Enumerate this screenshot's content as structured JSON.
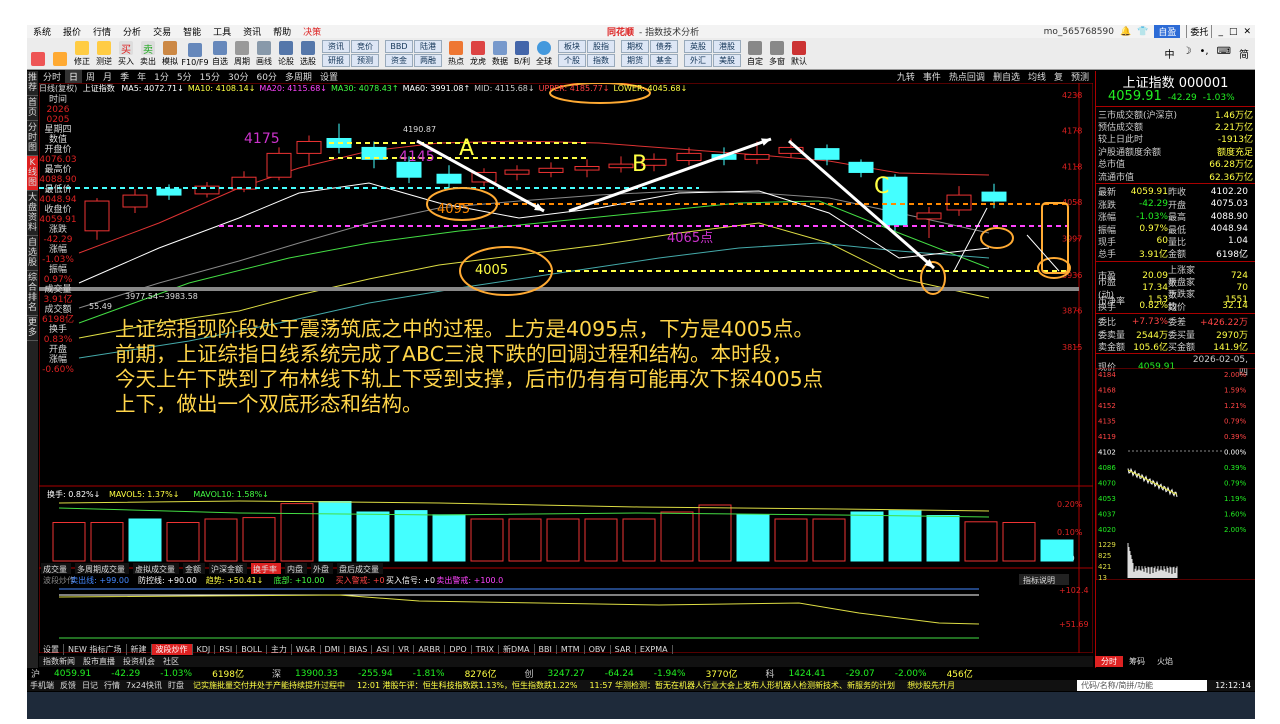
{
  "menu": {
    "items": [
      "系统",
      "报价",
      "行情",
      "分析",
      "交易",
      "智能",
      "工具",
      "资讯",
      "帮助",
      "决策"
    ],
    "brand": "同花顺",
    "window_title": "- 指数技术分析",
    "user": "mo_565768590",
    "right_buttons": [
      "自盈",
      "委托"
    ]
  },
  "toolbar": {
    "buttons": [
      "",
      "",
      "修正",
      "测逆",
      "买入",
      "卖出",
      "模拟",
      "F10/F9",
      "自选",
      "周期",
      "画线",
      "论股",
      "选股"
    ],
    "groups": [
      [
        "资讯",
        "竞价"
      ],
      [
        "研报",
        "预测"
      ],
      [
        "BBD",
        "资金"
      ],
      [
        "陆港",
        "两融"
      ]
    ],
    "buttons2": [
      "热点",
      "龙虎",
      "数据",
      "B/利"
    ],
    "buttons3": [
      "全球"
    ],
    "groups2": [
      [
        "板块",
        "个股"
      ],
      [
        "股指",
        "指数"
      ],
      [
        "期权",
        "期货"
      ],
      [
        "债券",
        "基金"
      ],
      [
        "英股",
        "外汇"
      ],
      [
        "港股",
        "美股"
      ]
    ],
    "buttons4": [
      "自定",
      "多窗",
      "默认"
    ]
  },
  "sidebar": [
    "推荐",
    "首页",
    "分时图",
    "K线图",
    "大盘资料",
    "自选股",
    "综合排名",
    "更多"
  ],
  "periods": {
    "items": [
      "分时",
      "日",
      "周",
      "月",
      "季",
      "年",
      "1分",
      "5分",
      "15分",
      "30分",
      "60分",
      "多周期",
      "设置"
    ],
    "active": "日",
    "right": [
      "九转",
      "事件",
      "热点回调",
      "删自选",
      "均线",
      "复",
      "预测"
    ]
  },
  "ma_line": {
    "label": "日线(复权)",
    "index": "上证指数",
    "items": [
      {
        "t": "MA5: 4072.71↓",
        "c": "#ffffff"
      },
      {
        "t": "MA10: 4108.14↓",
        "c": "#ffff44"
      },
      {
        "t": "MA20: 4115.68↓",
        "c": "#ff44ff"
      },
      {
        "t": "MA30: 4078.43↑",
        "c": "#44ff44"
      },
      {
        "t": "MA60: 3991.08↑",
        "c": "#ffffff"
      },
      {
        "t": "MID: 4115.68↓",
        "c": "#cccccc"
      },
      {
        "t": "UPPER: 4185.77↓",
        "c": "#ff4444"
      },
      {
        "t": "LOWER: 4045.68↓",
        "c": "#ffff44"
      }
    ]
  },
  "left_info": {
    "rows": [
      {
        "k": "时间",
        "v": "2026"
      },
      {
        "k": "",
        "v": "0205"
      },
      {
        "k": "星期四",
        "v": ""
      },
      {
        "k": "数值",
        "v": ""
      },
      {
        "k": "开盘价",
        "v": "4076.03"
      },
      {
        "k": "最高价",
        "v": "4088.90"
      },
      {
        "k": "最低价",
        "v": "4048.94"
      },
      {
        "k": "收盘价",
        "v": "4059.91"
      },
      {
        "k": "涨跌",
        "v": "-42.29"
      },
      {
        "k": "涨幅",
        "v": "-1.03%"
      },
      {
        "k": "振幅",
        "v": "0.97%"
      },
      {
        "k": "成交量",
        "v": "3.91亿"
      },
      {
        "k": "成交额",
        "v": "6198亿"
      },
      {
        "k": "换手",
        "v": "0.83%"
      },
      {
        "k": "开盘",
        "v": ""
      },
      {
        "k": "涨幅",
        "v": "-0.60%"
      }
    ]
  },
  "chart_labels": {
    "l4175": "4175",
    "l4145": "4145",
    "lA": "A",
    "lB": "B",
    "lC": "C",
    "l4095": "4095",
    "l4065": "4065点",
    "l4005": "4005",
    "peak": "4190.87",
    "low": "3977.54~3983.58",
    "left_v": "55.49"
  },
  "price_axis": [
    "4238",
    "4178",
    "4118",
    "4058",
    "3997",
    "3936",
    "3876",
    "3815"
  ],
  "annotation": [
    "上证综指现阶段处于震荡筑底之中的过程。上方是4095点，下方是4005点。",
    "前期，上证综指日线系统完成了ABC三浪下跌的回调过程和结构。本时段，",
    "今天上午下跌到了布林线下轨上下受到支撑，后市仍有有可能再次下探4005点",
    "上下，做出一个双底形态和结构。"
  ],
  "turnover_line": {
    "items": [
      {
        "t": "换手: 0.82%↓",
        "c": "#ffffff"
      },
      {
        "t": "MAVOL5: 1.37%↓",
        "c": "#ffff44"
      },
      {
        "t": "MAVOL10: 1.58%↓",
        "c": "#44ff44"
      }
    ],
    "axis": [
      "0.20%",
      "0.10%",
      "X10"
    ]
  },
  "turnover_tabs": [
    "成交量",
    "多周期成交量",
    "虚拟成交量",
    "金额",
    "沪深金额",
    "换手率",
    "内盘",
    "外盘",
    "盘后成交量"
  ],
  "bottom_ind": {
    "items": [
      {
        "t": "波段炒作",
        "c": "#888888"
      },
      {
        "t": "卖出线: +99.00",
        "c": "#4488ff"
      },
      {
        "t": "防控线: +90.00",
        "c": "#ffffff"
      },
      {
        "t": "趋势: +50.41↓",
        "c": "#ffff44"
      },
      {
        "t": "底部: +10.00",
        "c": "#44ff44"
      },
      {
        "t": "买入警戒: +0",
        "c": "#ff4444"
      },
      {
        "t": "买入信号: +0",
        "c": "#ffffff"
      },
      {
        "t": "卖出警戒: +100.0",
        "c": "#ff44ff"
      }
    ],
    "axis": [
      "+102.4",
      "+51.69"
    ],
    "explain": "指标说明"
  },
  "bottom_tabs": {
    "items": [
      "设置",
      "NEW 指标广场",
      "新建",
      "波段炒作",
      "KDJ",
      "RSI",
      "BOLL",
      "主力",
      "W&R",
      "DMI",
      "BIAS",
      "ASI",
      "VR",
      "ARBR",
      "DPO",
      "TRIX",
      "新DMA",
      "BBI",
      "MTM",
      "OBV",
      "SAR",
      "EXPMA"
    ],
    "active": "波段炒作"
  },
  "sub_tabs": [
    "指数新闻",
    "股市直播",
    "投资机会",
    "社区"
  ],
  "right_tabs": {
    "items": [
      "分时",
      "筹码",
      "火焰"
    ],
    "active": "分时"
  },
  "right_panel": {
    "title": "上证指数 000001",
    "price": "4059.91",
    "change": "-42.29",
    "pct": "-1.03%",
    "stats": [
      {
        "k": "三市成交额(沪深京)",
        "v": "1.46万亿"
      },
      {
        "k": "预估成交额",
        "v": "2.21万亿"
      },
      {
        "k": "较上日此时",
        "v": "-1913亿"
      },
      {
        "k": "沪股通额度余额",
        "v": "额度充足"
      },
      {
        "k": "总市值",
        "v": "66.28万亿"
      },
      {
        "k": "流通市值",
        "v": "62.36万亿"
      }
    ],
    "grid": [
      [
        "最新",
        "4059.91",
        "昨收",
        "4102.20"
      ],
      [
        "涨跌",
        "-42.29",
        "开盘",
        "4075.03"
      ],
      [
        "涨幅",
        "-1.03%",
        "最高",
        "4088.90"
      ],
      [
        "振幅",
        "0.97%",
        "最低",
        "4048.94"
      ],
      [
        "现手",
        "60",
        "量比",
        "1.04"
      ],
      [
        "总手",
        "3.91亿",
        "金额",
        "6198亿"
      ]
    ],
    "grid2": [
      [
        "市盈",
        "20.09",
        "上涨家数",
        "724"
      ],
      [
        "市盈(动)",
        "17.34",
        "平盘家数",
        "70"
      ],
      [
        "市净率",
        "1.53",
        "下跌家数",
        "1551"
      ],
      [
        "换手",
        "0.82%",
        "均价",
        "32.14"
      ]
    ],
    "grid3": [
      [
        "委比",
        "+7.73%",
        "委差",
        "+426.22万"
      ],
      [
        "委卖量",
        "2544万",
        "委买量",
        "2970万"
      ],
      [
        "卖金额",
        "105.6亿",
        "买金额",
        "141.9亿"
      ]
    ],
    "mini_head": {
      "k": "现价",
      "v": "4059.91",
      "d": "2026-02-05,四"
    },
    "mini_axis": [
      "4184",
      "4168",
      "4152",
      "4135",
      "4119",
      "4102",
      "4086",
      "4070",
      "4053",
      "4037",
      "4020",
      "1229",
      "825",
      "421",
      "13"
    ],
    "mini_pct": [
      "2.00%",
      "1.59%",
      "1.21%",
      "0.79%",
      "0.39%",
      "0.00%",
      "0.39%",
      "0.79%",
      "1.19%",
      "1.60%",
      "2.00%"
    ]
  },
  "index_bar": [
    {
      "t": "沪",
      "c": "#ccc"
    },
    {
      "t": "4059.91",
      "c": "#2e2"
    },
    {
      "t": "-42.29",
      "c": "#2e2"
    },
    {
      "t": "-1.03%",
      "c": "#2e2"
    },
    {
      "t": "6198亿",
      "c": "#ff4"
    },
    {
      "t": "深",
      "c": "#ccc"
    },
    {
      "t": "13900.33",
      "c": "#2e2"
    },
    {
      "t": "-255.94",
      "c": "#2e2"
    },
    {
      "t": "-1.81%",
      "c": "#2e2"
    },
    {
      "t": "8276亿",
      "c": "#ff4"
    },
    {
      "t": "创",
      "c": "#ccc"
    },
    {
      "t": "3247.27",
      "c": "#2e2"
    },
    {
      "t": "-64.24",
      "c": "#2e2"
    },
    {
      "t": "-1.94%",
      "c": "#2e2"
    },
    {
      "t": "3770亿",
      "c": "#ff4"
    },
    {
      "t": "科",
      "c": "#ccc"
    },
    {
      "t": "1424.41",
      "c": "#2e2"
    },
    {
      "t": "-29.07",
      "c": "#2e2"
    },
    {
      "t": "-2.00%",
      "c": "#2e2"
    },
    {
      "t": "456亿",
      "c": "#ff4"
    }
  ],
  "news_bar": {
    "left": [
      "手机端",
      "反馈",
      "日记",
      "行情",
      "7x24快讯",
      "盯盘"
    ],
    "items": [
      "记实施批量交付并处于产能持续提升过程中",
      "12:01 港股午评：恒生科技指数跌1.13%，恒生指数跌1.22%",
      "11:57 华测检测：暂无在机器人行业大会上发布人形机器人检测新技术、新服务的计划",
      "想炒股先升月"
    ],
    "search": "代码/名称/简拼/功能",
    "time": "12:12:14"
  },
  "colors": {
    "up": "#ff4444",
    "down": "#44ffff",
    "accent": "#d22222",
    "yellow": "#ffff44"
  }
}
